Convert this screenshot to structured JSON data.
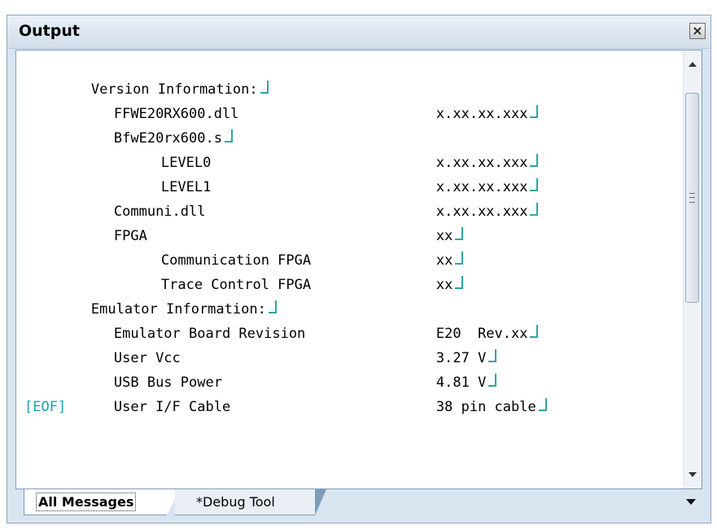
{
  "window": {
    "title": "Output",
    "close_glyph": "×"
  },
  "output": {
    "lines": [
      {
        "label": "Version Information:",
        "value": ""
      },
      {
        "label": "FFWE20RX600.dll",
        "value": "x.xx.xx.xxx"
      },
      {
        "label": "BfwE20rx600.s",
        "value": ""
      },
      {
        "label": "LEVEL0",
        "value": "x.xx.xx.xxx"
      },
      {
        "label": "LEVEL1",
        "value": "x.xx.xx.xxx"
      },
      {
        "label": "Communi.dll",
        "value": "x.xx.xx.xxx"
      },
      {
        "label": "FPGA",
        "value": "xx"
      },
      {
        "label": "Communication FPGA",
        "value": "xx"
      },
      {
        "label": "Trace Control FPGA",
        "value": "xx"
      },
      {
        "label": "Emulator Information:",
        "value": ""
      },
      {
        "label": "Emulator Board Revision",
        "value": "E20  Rev.xx"
      },
      {
        "label": "User Vcc",
        "value": "3.27 V"
      },
      {
        "label": "USB Bus Power",
        "value": "4.81 V"
      },
      {
        "label": "User I/F Cable",
        "value": "38 pin cable"
      }
    ],
    "eof": "[EOF]"
  },
  "tabs": [
    {
      "label": "All Messages",
      "active": true
    },
    {
      "label": "*Debug Tool",
      "active": false
    }
  ],
  "icons": {
    "close": "close-icon",
    "newline": "newline-icon",
    "scroll_up": "arrow-up-icon",
    "scroll_down": "arrow-down-icon",
    "tab_menu": "dropdown-icon"
  },
  "colors": {
    "newline_marker": "#2aa7a0",
    "eof_text": "#1aa2b0",
    "frame": "#d8e4f0"
  }
}
